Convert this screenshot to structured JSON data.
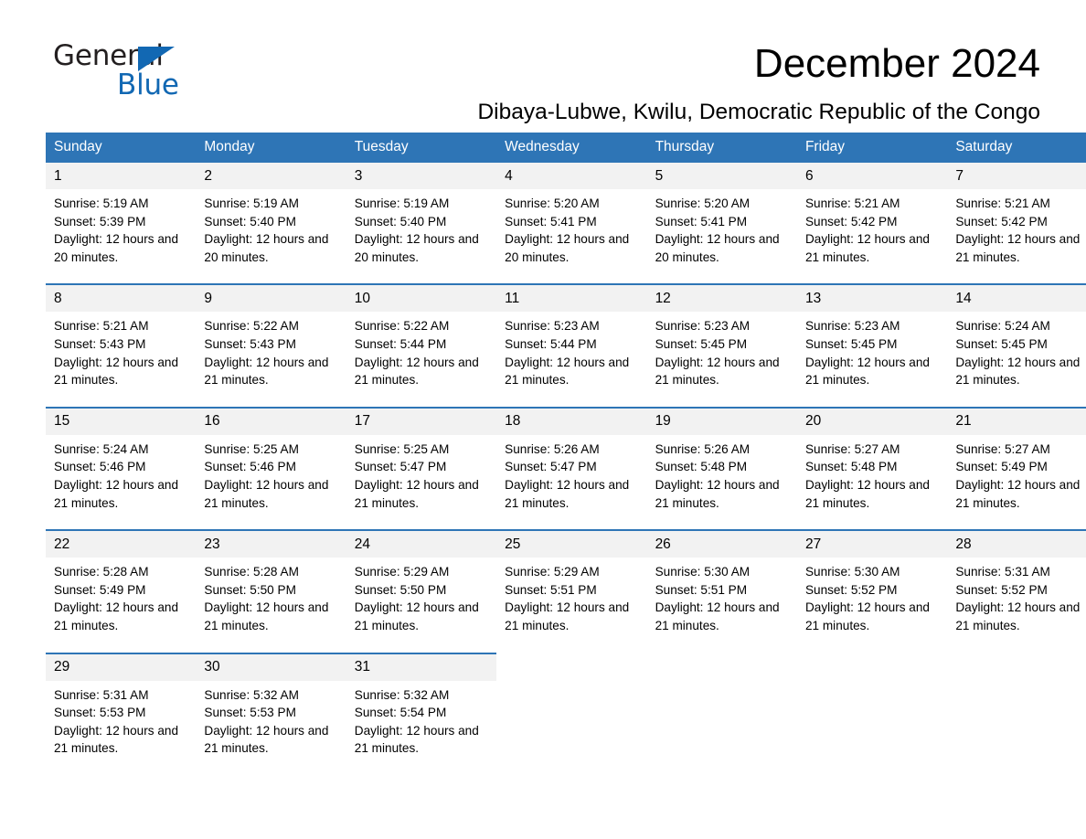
{
  "brand": {
    "name_part1": "General",
    "name_part2": "Blue",
    "accent_color": "#1268b3",
    "triangle_icon": "triangle-icon"
  },
  "header": {
    "month_title": "December 2024",
    "location": "Dibaya-Lubwe, Kwilu, Democratic Republic of the Congo"
  },
  "theme": {
    "header_blue": "#2e75b6",
    "daynum_band": "#f2f2f2",
    "page_background": "#ffffff"
  },
  "weekday_headers": [
    "Sunday",
    "Monday",
    "Tuesday",
    "Wednesday",
    "Thursday",
    "Friday",
    "Saturday"
  ],
  "weeks": [
    {
      "days": [
        {
          "date": "1",
          "sunrise": "Sunrise: 5:19 AM",
          "sunset": "Sunset: 5:39 PM",
          "daylight": "Daylight: 12 hours and 20 minutes."
        },
        {
          "date": "2",
          "sunrise": "Sunrise: 5:19 AM",
          "sunset": "Sunset: 5:40 PM",
          "daylight": "Daylight: 12 hours and 20 minutes."
        },
        {
          "date": "3",
          "sunrise": "Sunrise: 5:19 AM",
          "sunset": "Sunset: 5:40 PM",
          "daylight": "Daylight: 12 hours and 20 minutes."
        },
        {
          "date": "4",
          "sunrise": "Sunrise: 5:20 AM",
          "sunset": "Sunset: 5:41 PM",
          "daylight": "Daylight: 12 hours and 20 minutes."
        },
        {
          "date": "5",
          "sunrise": "Sunrise: 5:20 AM",
          "sunset": "Sunset: 5:41 PM",
          "daylight": "Daylight: 12 hours and 20 minutes."
        },
        {
          "date": "6",
          "sunrise": "Sunrise: 5:21 AM",
          "sunset": "Sunset: 5:42 PM",
          "daylight": "Daylight: 12 hours and 21 minutes."
        },
        {
          "date": "7",
          "sunrise": "Sunrise: 5:21 AM",
          "sunset": "Sunset: 5:42 PM",
          "daylight": "Daylight: 12 hours and 21 minutes."
        }
      ]
    },
    {
      "days": [
        {
          "date": "8",
          "sunrise": "Sunrise: 5:21 AM",
          "sunset": "Sunset: 5:43 PM",
          "daylight": "Daylight: 12 hours and 21 minutes."
        },
        {
          "date": "9",
          "sunrise": "Sunrise: 5:22 AM",
          "sunset": "Sunset: 5:43 PM",
          "daylight": "Daylight: 12 hours and 21 minutes."
        },
        {
          "date": "10",
          "sunrise": "Sunrise: 5:22 AM",
          "sunset": "Sunset: 5:44 PM",
          "daylight": "Daylight: 12 hours and 21 minutes."
        },
        {
          "date": "11",
          "sunrise": "Sunrise: 5:23 AM",
          "sunset": "Sunset: 5:44 PM",
          "daylight": "Daylight: 12 hours and 21 minutes."
        },
        {
          "date": "12",
          "sunrise": "Sunrise: 5:23 AM",
          "sunset": "Sunset: 5:45 PM",
          "daylight": "Daylight: 12 hours and 21 minutes."
        },
        {
          "date": "13",
          "sunrise": "Sunrise: 5:23 AM",
          "sunset": "Sunset: 5:45 PM",
          "daylight": "Daylight: 12 hours and 21 minutes."
        },
        {
          "date": "14",
          "sunrise": "Sunrise: 5:24 AM",
          "sunset": "Sunset: 5:45 PM",
          "daylight": "Daylight: 12 hours and 21 minutes."
        }
      ]
    },
    {
      "days": [
        {
          "date": "15",
          "sunrise": "Sunrise: 5:24 AM",
          "sunset": "Sunset: 5:46 PM",
          "daylight": "Daylight: 12 hours and 21 minutes."
        },
        {
          "date": "16",
          "sunrise": "Sunrise: 5:25 AM",
          "sunset": "Sunset: 5:46 PM",
          "daylight": "Daylight: 12 hours and 21 minutes."
        },
        {
          "date": "17",
          "sunrise": "Sunrise: 5:25 AM",
          "sunset": "Sunset: 5:47 PM",
          "daylight": "Daylight: 12 hours and 21 minutes."
        },
        {
          "date": "18",
          "sunrise": "Sunrise: 5:26 AM",
          "sunset": "Sunset: 5:47 PM",
          "daylight": "Daylight: 12 hours and 21 minutes."
        },
        {
          "date": "19",
          "sunrise": "Sunrise: 5:26 AM",
          "sunset": "Sunset: 5:48 PM",
          "daylight": "Daylight: 12 hours and 21 minutes."
        },
        {
          "date": "20",
          "sunrise": "Sunrise: 5:27 AM",
          "sunset": "Sunset: 5:48 PM",
          "daylight": "Daylight: 12 hours and 21 minutes."
        },
        {
          "date": "21",
          "sunrise": "Sunrise: 5:27 AM",
          "sunset": "Sunset: 5:49 PM",
          "daylight": "Daylight: 12 hours and 21 minutes."
        }
      ]
    },
    {
      "days": [
        {
          "date": "22",
          "sunrise": "Sunrise: 5:28 AM",
          "sunset": "Sunset: 5:49 PM",
          "daylight": "Daylight: 12 hours and 21 minutes."
        },
        {
          "date": "23",
          "sunrise": "Sunrise: 5:28 AM",
          "sunset": "Sunset: 5:50 PM",
          "daylight": "Daylight: 12 hours and 21 minutes."
        },
        {
          "date": "24",
          "sunrise": "Sunrise: 5:29 AM",
          "sunset": "Sunset: 5:50 PM",
          "daylight": "Daylight: 12 hours and 21 minutes."
        },
        {
          "date": "25",
          "sunrise": "Sunrise: 5:29 AM",
          "sunset": "Sunset: 5:51 PM",
          "daylight": "Daylight: 12 hours and 21 minutes."
        },
        {
          "date": "26",
          "sunrise": "Sunrise: 5:30 AM",
          "sunset": "Sunset: 5:51 PM",
          "daylight": "Daylight: 12 hours and 21 minutes."
        },
        {
          "date": "27",
          "sunrise": "Sunrise: 5:30 AM",
          "sunset": "Sunset: 5:52 PM",
          "daylight": "Daylight: 12 hours and 21 minutes."
        },
        {
          "date": "28",
          "sunrise": "Sunrise: 5:31 AM",
          "sunset": "Sunset: 5:52 PM",
          "daylight": "Daylight: 12 hours and 21 minutes."
        }
      ]
    },
    {
      "days": [
        {
          "date": "29",
          "sunrise": "Sunrise: 5:31 AM",
          "sunset": "Sunset: 5:53 PM",
          "daylight": "Daylight: 12 hours and 21 minutes."
        },
        {
          "date": "30",
          "sunrise": "Sunrise: 5:32 AM",
          "sunset": "Sunset: 5:53 PM",
          "daylight": "Daylight: 12 hours and 21 minutes."
        },
        {
          "date": "31",
          "sunrise": "Sunrise: 5:32 AM",
          "sunset": "Sunset: 5:54 PM",
          "daylight": "Daylight: 12 hours and 21 minutes."
        },
        {
          "date": "",
          "sunrise": "",
          "sunset": "",
          "daylight": ""
        },
        {
          "date": "",
          "sunrise": "",
          "sunset": "",
          "daylight": ""
        },
        {
          "date": "",
          "sunrise": "",
          "sunset": "",
          "daylight": ""
        },
        {
          "date": "",
          "sunrise": "",
          "sunset": "",
          "daylight": ""
        }
      ]
    }
  ]
}
